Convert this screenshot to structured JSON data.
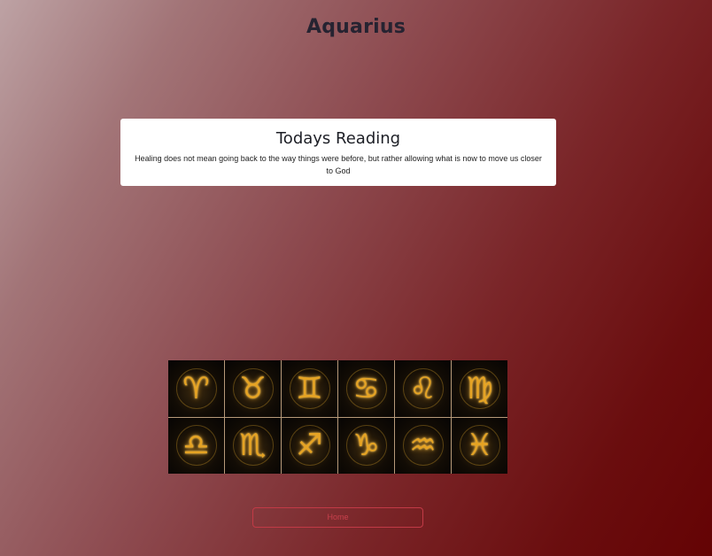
{
  "page": {
    "title": "Aquarius"
  },
  "reading": {
    "heading": "Todays Reading",
    "text": "Healing does not mean going back to the way things were before, but rather allowing what is now to move us closer to God"
  },
  "zodiac": [
    {
      "name": "aries",
      "glyph": "♈"
    },
    {
      "name": "taurus",
      "glyph": "♉"
    },
    {
      "name": "gemini",
      "glyph": "♊"
    },
    {
      "name": "cancer",
      "glyph": "♋"
    },
    {
      "name": "leo",
      "glyph": "♌"
    },
    {
      "name": "virgo",
      "glyph": "♍"
    },
    {
      "name": "libra",
      "glyph": "♎"
    },
    {
      "name": "scorpio",
      "glyph": "♏"
    },
    {
      "name": "sagittarius",
      "glyph": "♐"
    },
    {
      "name": "capricorn",
      "glyph": "♑"
    },
    {
      "name": "aquarius",
      "glyph": "♒"
    },
    {
      "name": "pisces",
      "glyph": "♓"
    }
  ],
  "nav": {
    "home_label": "Home"
  },
  "colors": {
    "background_start": "#bda2a4",
    "background_end": "#640304",
    "accent": "#c23a46",
    "gold": "#e5a324"
  }
}
